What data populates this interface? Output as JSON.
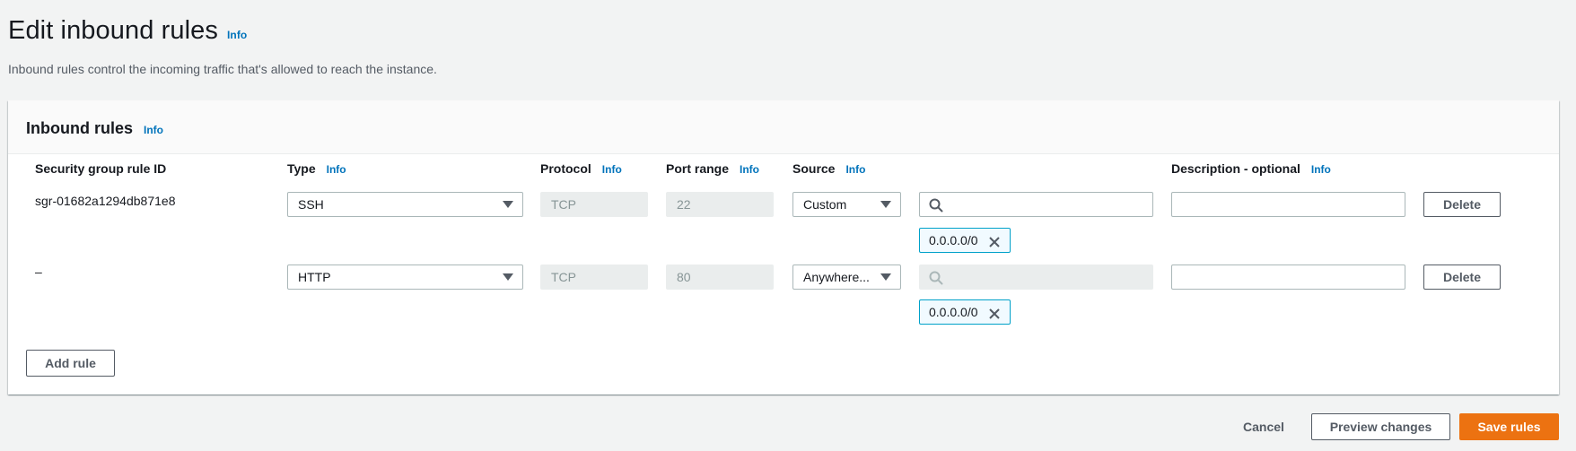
{
  "page": {
    "title": "Edit inbound rules",
    "info": "Info",
    "description": "Inbound rules control the incoming traffic that's allowed to reach the instance."
  },
  "panel": {
    "title": "Inbound rules",
    "info": "Info",
    "columns": {
      "rule_id": "Security group rule ID",
      "type": "Type",
      "protocol": "Protocol",
      "port_range": "Port range",
      "source": "Source",
      "description": "Description - optional"
    },
    "column_info": "Info",
    "rows": [
      {
        "rule_id": "sgr-01682a1294db871e8",
        "type": "SSH",
        "protocol": "TCP",
        "port_range": "22",
        "source_type": "Custom",
        "source_search": "",
        "source_token": "0.0.0.0/0",
        "description": "",
        "delete_label": "Delete"
      },
      {
        "rule_id": "–",
        "type": "HTTP",
        "protocol": "TCP",
        "port_range": "80",
        "source_type": "Anywhere...",
        "source_search": "",
        "source_token": "0.0.0.0/0",
        "description": "",
        "delete_label": "Delete"
      }
    ],
    "add_rule_label": "Add rule"
  },
  "footer": {
    "cancel_label": "Cancel",
    "preview_label": "Preview changes",
    "save_label": "Save rules"
  },
  "colors": {
    "accent": "#ec7211",
    "link": "#0073bb",
    "token_border": "#00a1c9"
  },
  "icons": {
    "search": "search-icon",
    "token_remove": "close-icon",
    "dropdown": "caret-down-icon"
  }
}
